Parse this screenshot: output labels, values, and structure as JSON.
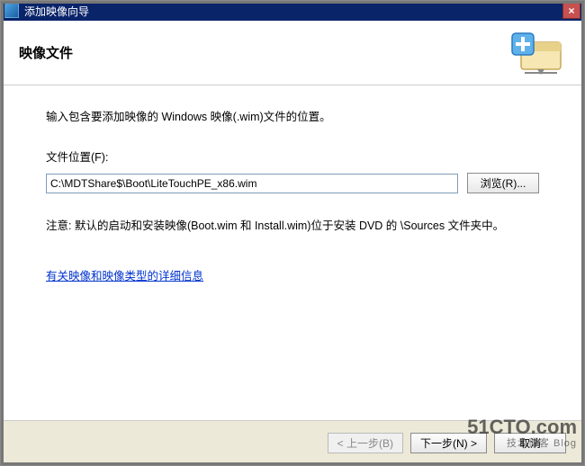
{
  "titlebar": {
    "title": "添加映像向导",
    "close_label": "×"
  },
  "header": {
    "page_title": "映像文件"
  },
  "content": {
    "instruction": "输入包含要添加映像的 Windows 映像(.wim)文件的位置。",
    "field_label": "文件位置(F):",
    "file_path_value": "C:\\MDTShare$\\Boot\\LiteTouchPE_x86.wim",
    "browse_label": "浏览(R)...",
    "note_text": "注意: 默认的启动和安装映像(Boot.wim 和 Install.wim)位于安装 DVD 的 \\Sources 文件夹中。",
    "link_text": "有关映像和映像类型的详细信息"
  },
  "footer": {
    "back_label": "< 上一步(B)",
    "next_label": "下一步(N) >",
    "cancel_label": "取消"
  },
  "watermark": {
    "line1": "51CTO.com",
    "line2": "技术博客  Blog"
  }
}
